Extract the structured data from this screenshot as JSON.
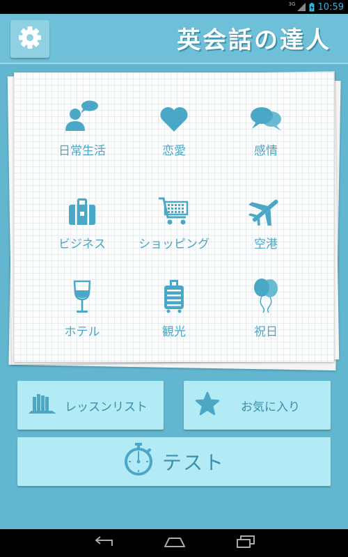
{
  "status_bar": {
    "network": "3G",
    "time": "10:59"
  },
  "header": {
    "title": "英会話の達人",
    "settings_icon": "gear-icon"
  },
  "categories": [
    {
      "label": "日常生活",
      "icon": "person-speech-icon"
    },
    {
      "label": "恋愛",
      "icon": "heart-icon"
    },
    {
      "label": "感情",
      "icon": "speech-bubbles-icon"
    },
    {
      "label": "ビジネス",
      "icon": "briefcase-icon"
    },
    {
      "label": "ショッピング",
      "icon": "shopping-cart-icon"
    },
    {
      "label": "空港",
      "icon": "airplane-icon"
    },
    {
      "label": "ホテル",
      "icon": "wine-glass-icon"
    },
    {
      "label": "観光",
      "icon": "suitcase-icon"
    },
    {
      "label": "祝日",
      "icon": "balloons-icon"
    }
  ],
  "buttons": {
    "lesson_list": "レッスンリスト",
    "favorites": "お気に入り",
    "test": "テスト"
  },
  "colors": {
    "background": "#63b6cf",
    "header": "#6ec0d8",
    "icon": "#4aa7c6",
    "button": "#b2eaf6",
    "status_accent": "#33b5e5"
  }
}
